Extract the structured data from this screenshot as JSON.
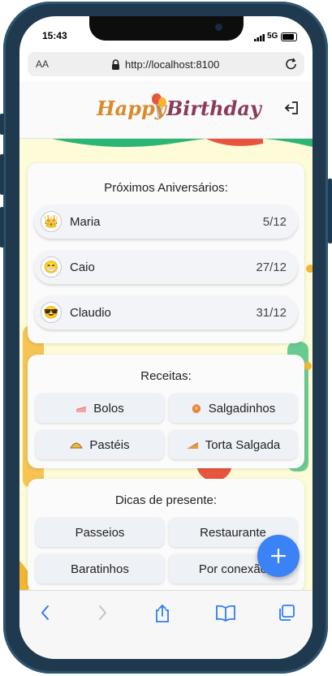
{
  "status": {
    "time": "15:43",
    "network": "5G"
  },
  "browser": {
    "aa_label": "AA",
    "url": "http://localhost:8100"
  },
  "app": {
    "logo_word1": "Happy",
    "logo_word2": "Birthday"
  },
  "birthdays": {
    "title": "Próximos Aniversários:",
    "items": [
      {
        "emoji": "👑",
        "name": "Maria",
        "date": "5/12"
      },
      {
        "emoji": "😁",
        "name": "Caio",
        "date": "27/12"
      },
      {
        "emoji": "😎",
        "name": "Claudio",
        "date": "31/12"
      }
    ]
  },
  "recipes": {
    "title": "Receitas:",
    "items": [
      {
        "label": "Bolos",
        "icon": "cake-icon"
      },
      {
        "label": "Salgadinhos",
        "icon": "salgadinho-icon"
      },
      {
        "label": "Pastéis",
        "icon": "pastel-icon"
      },
      {
        "label": "Torta Salgada",
        "icon": "pie-icon"
      }
    ]
  },
  "gifts": {
    "title": "Dicas de presente:",
    "items": [
      {
        "label": "Passeios"
      },
      {
        "label": "Restaurante"
      },
      {
        "label": "Baratinhos"
      },
      {
        "label": "Por conexão"
      }
    ]
  },
  "colors": {
    "fab": "#3b82f6",
    "ios_blue": "#2f7cf6"
  }
}
